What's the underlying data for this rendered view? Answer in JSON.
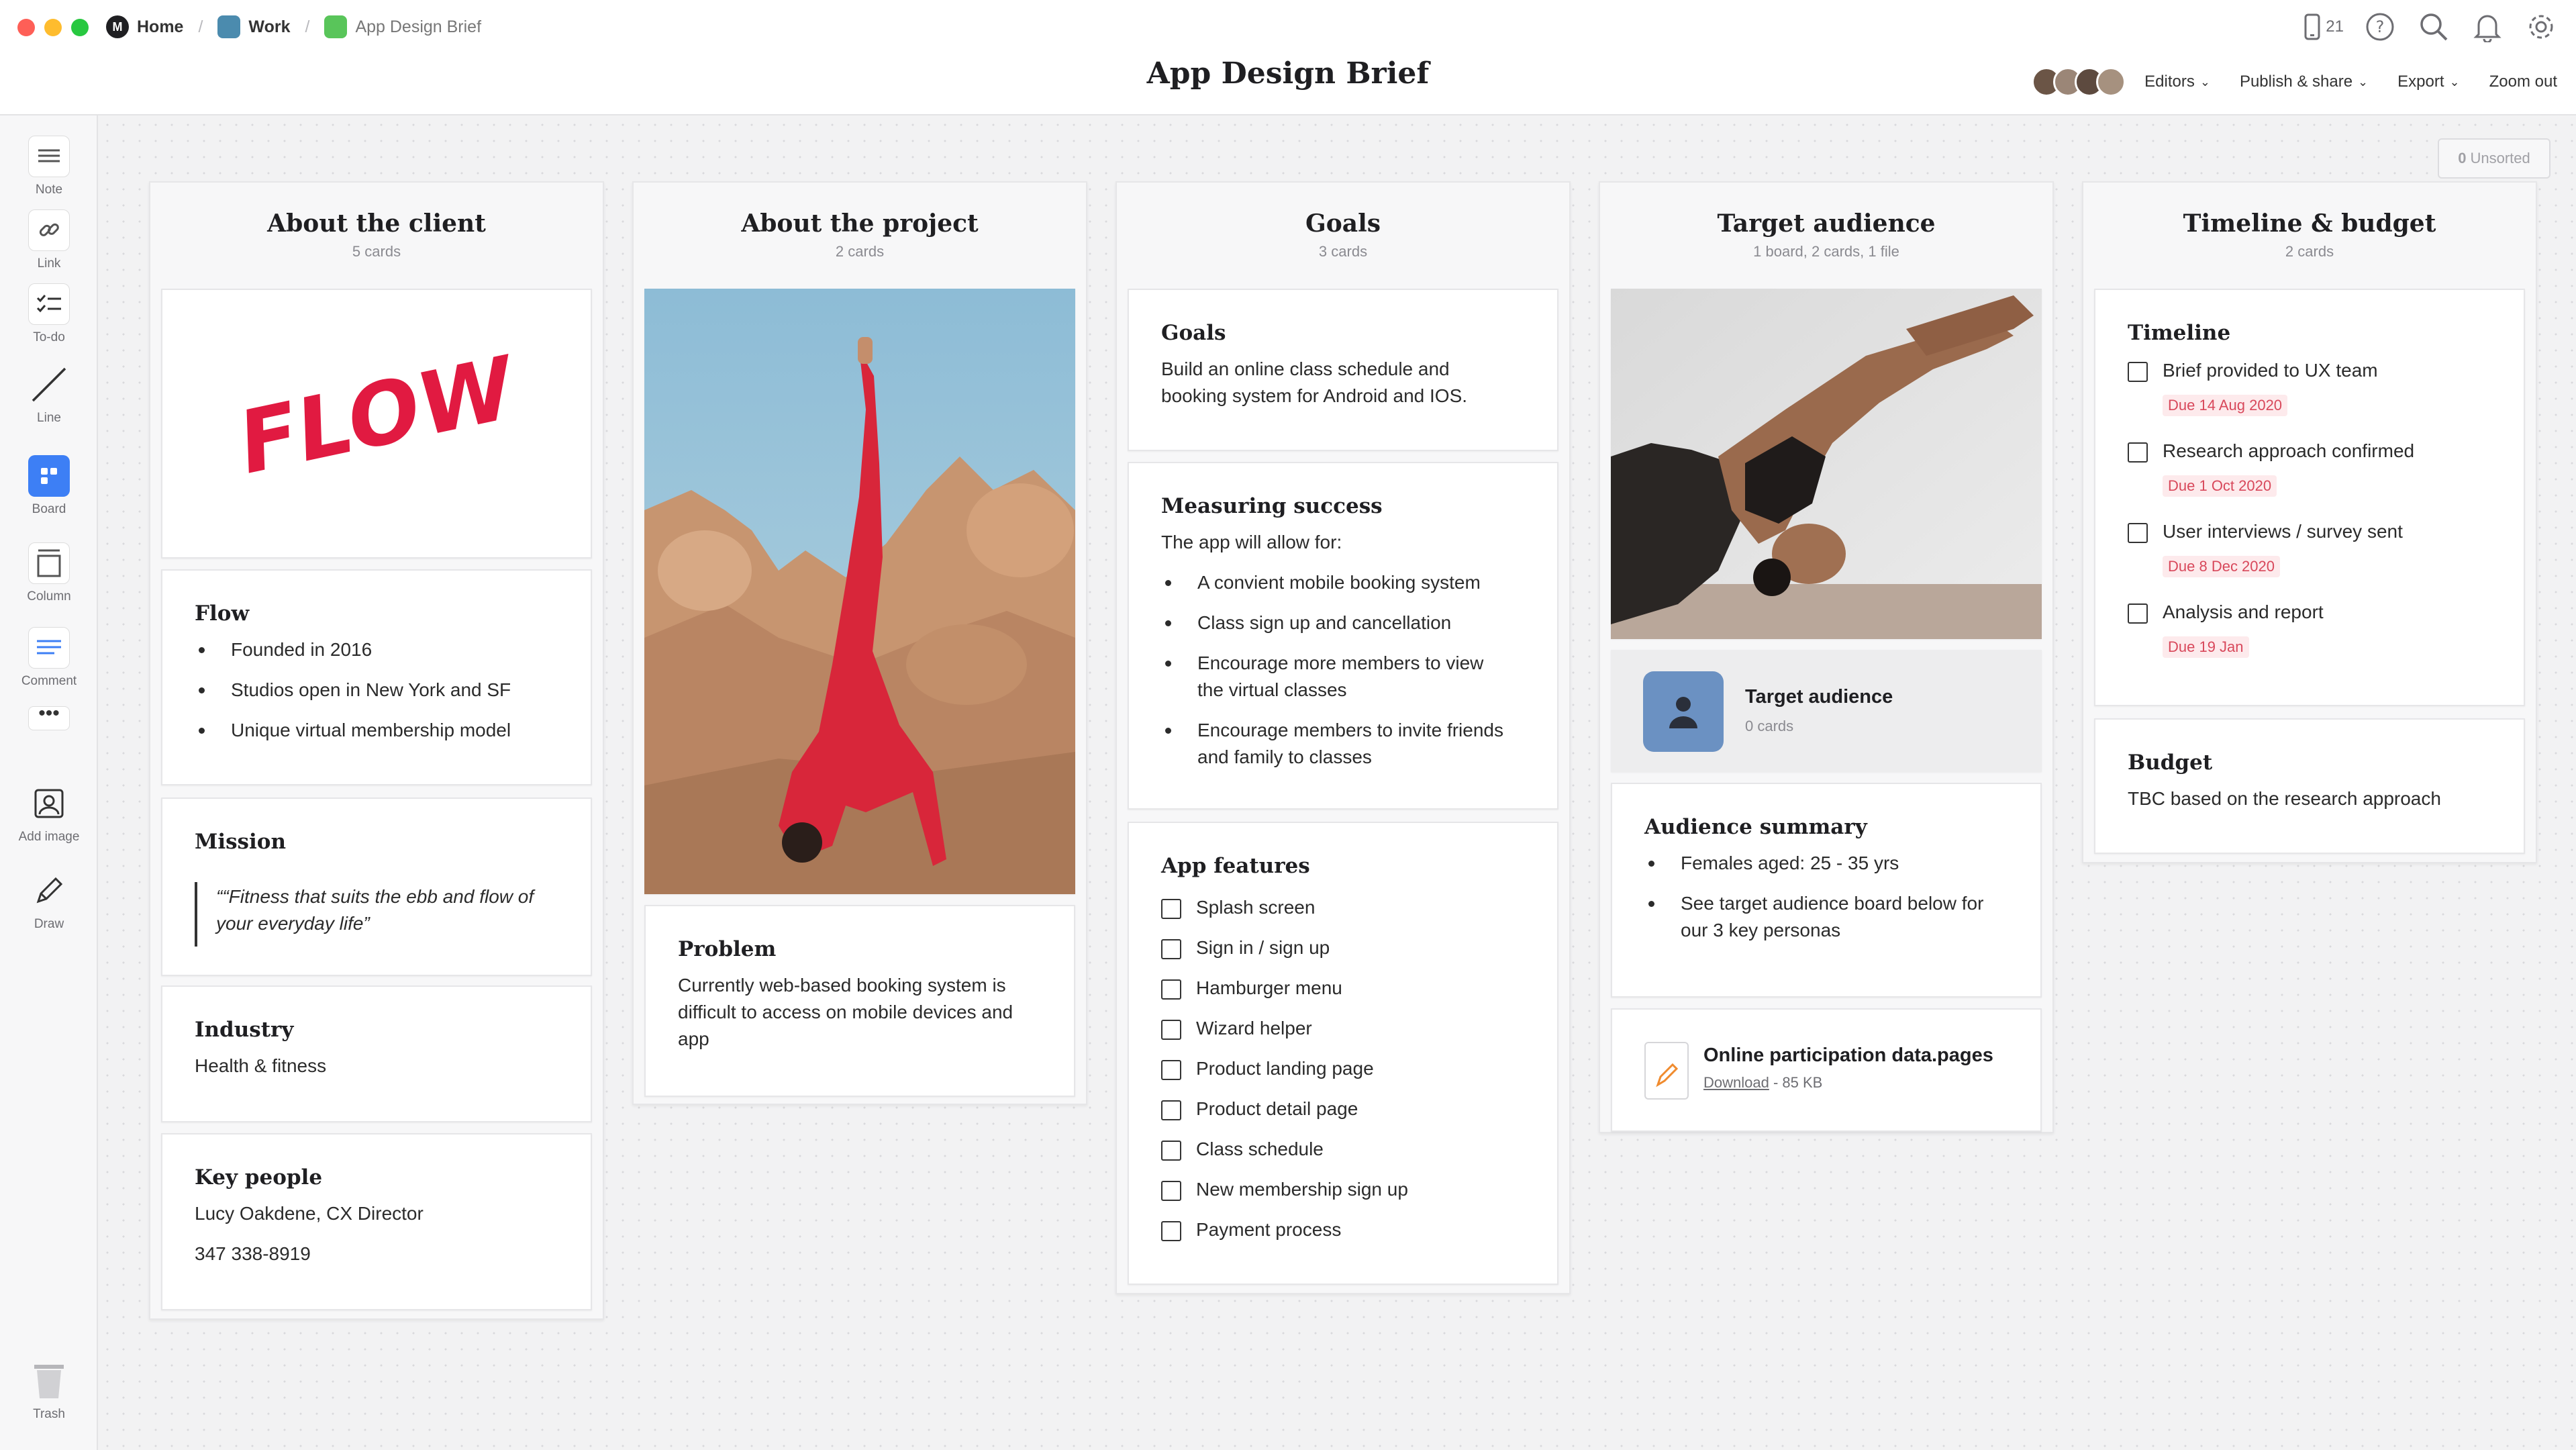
{
  "topbar": {
    "breadcrumbs": [
      "Home",
      "Work",
      "App Design Brief"
    ],
    "title": "App Design Brief",
    "device_count": "21",
    "menu": [
      "Editors",
      "Publish & share",
      "Export",
      "Zoom out"
    ]
  },
  "toolbar": [
    "Note",
    "Link",
    "To-do",
    "Line",
    "Board",
    "Column",
    "Comment",
    "Add image",
    "Draw",
    "Trash"
  ],
  "unsorted": {
    "count": "0",
    "label": "Unsorted"
  },
  "columns": {
    "client": {
      "title": "About the client",
      "sub": "5 cards",
      "logo_text": "FLOW",
      "flow": {
        "title": "Flow",
        "items": [
          "Founded in 2016",
          "Studios open in New York and SF",
          "Unique virtual membership model"
        ]
      },
      "mission": {
        "title": "Mission",
        "line1": "““Fitness that suits the ebb and flow of",
        "line2": "your everyday life”"
      },
      "industry": {
        "title": "Industry",
        "text": "Health & fitness"
      },
      "people": {
        "title": "Key people",
        "name": "Lucy Oakdene, CX Director",
        "phone": "347 338-8919"
      }
    },
    "project": {
      "title": "About the project",
      "sub": "2 cards",
      "problem": {
        "title": "Problem",
        "lines": [
          "Currently web-based booking system is",
          "difficult to access on mobile devices and",
          "app"
        ]
      }
    },
    "goals": {
      "title": "Goals",
      "sub": "3 cards",
      "goals": {
        "title": "Goals",
        "lines": [
          "Build an online class schedule and",
          "booking system for Android and IOS."
        ]
      },
      "measuring": {
        "title": "Measuring success",
        "intro": "The app will allow for:",
        "items": [
          [
            "A convient mobile booking system"
          ],
          [
            "Class sign up and cancellation"
          ],
          [
            "Encourage more members to view",
            "the virtual classes"
          ],
          [
            "Encourage members to invite friends",
            "and family to classes"
          ]
        ]
      },
      "features": {
        "title": "App features",
        "items": [
          "Splash screen",
          "Sign in / sign up",
          "Hamburger menu",
          "Wizard helper",
          "Product landing page",
          "Product detail page",
          "Class schedule",
          "New membership sign up",
          "Payment process"
        ]
      }
    },
    "audience": {
      "title": "Target audience",
      "sub": "1 board, 2 cards, 1 file",
      "board": {
        "title": "Target audience",
        "sub": "0 cards"
      },
      "summary": {
        "title": "Audience summary",
        "items": [
          [
            "Females aged: 25 - 35 yrs"
          ],
          [
            "See target audience board below for",
            "our 3 key personas"
          ]
        ]
      },
      "file": {
        "name": "Online participation data.pages",
        "download": "Download",
        "size": "- 85 KB"
      }
    },
    "timeline": {
      "title": "Timeline & budget",
      "sub": "2 cards",
      "timeline": {
        "title": "Timeline",
        "items": [
          {
            "label": "Brief provided to UX team",
            "due": "Due 14 Aug 2020"
          },
          {
            "label": "Research approach confirmed",
            "due": "Due 1 Oct 2020"
          },
          {
            "label": "User interviews / survey sent",
            "due": "Due 8 Dec 2020"
          },
          {
            "label": "Analysis and report",
            "due": "Due 19 Jan"
          }
        ]
      },
      "budget": {
        "title": "Budget",
        "text": "TBC based on the research approach"
      }
    }
  },
  "colors": {
    "accent": "#3d7ff5",
    "brand_red": "#e11a41",
    "due_red": "#d8485b"
  }
}
